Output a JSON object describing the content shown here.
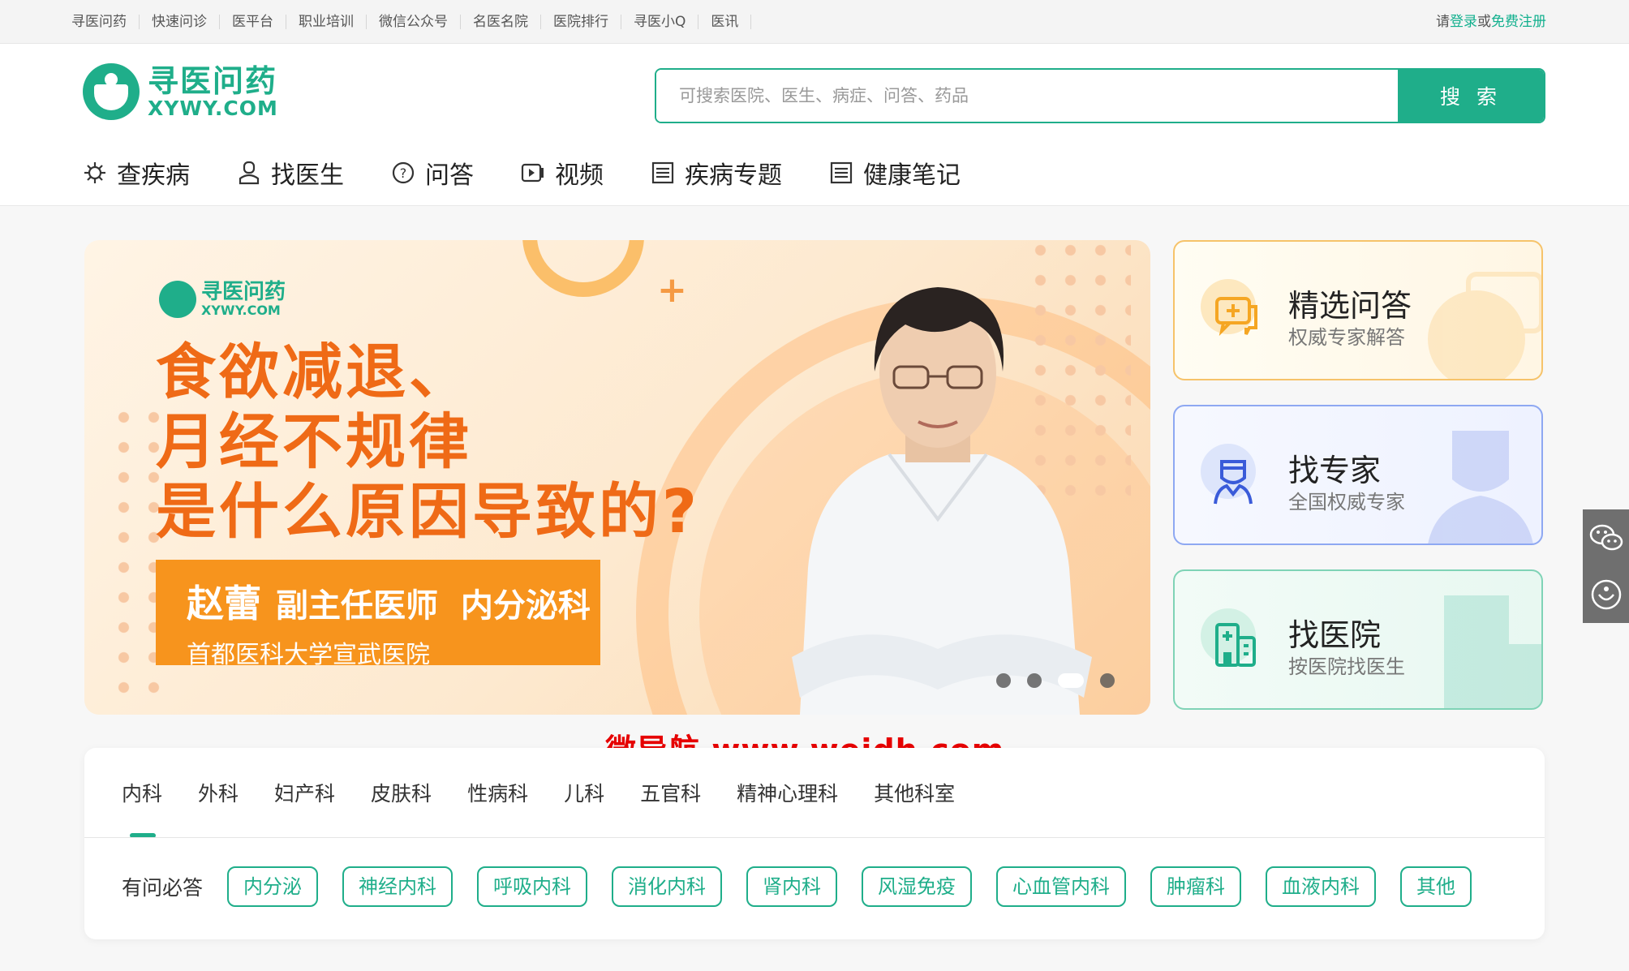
{
  "topbar": {
    "links": [
      "寻医问药",
      "快速问诊",
      "医平台",
      "职业培训",
      "微信公众号",
      "名医名院",
      "医院排行",
      "寻医小Q",
      "医讯"
    ],
    "login_prefix": "请",
    "login": "登录",
    "or": "或",
    "register": "免费注册"
  },
  "logo": {
    "cn": "寻医问药",
    "en": "XYWY.COM"
  },
  "search": {
    "placeholder": "可搜索医院、医生、病症、问答、药品",
    "button": "搜 索"
  },
  "nav": [
    {
      "label": "查疾病",
      "icon": "virus-icon"
    },
    {
      "label": "找医生",
      "icon": "doctor-icon"
    },
    {
      "label": "问答",
      "icon": "question-icon"
    },
    {
      "label": "视频",
      "icon": "video-icon"
    },
    {
      "label": "疾病专题",
      "icon": "topic-icon"
    },
    {
      "label": "健康笔记",
      "icon": "note-icon"
    }
  ],
  "banner": {
    "logo_cn": "寻医问药",
    "logo_en": "XYWY.COM",
    "headline": [
      "食欲减退、",
      "月经不规律",
      "是什么原因导致的?"
    ],
    "doctor_name": "赵蕾",
    "doctor_title": "副主任医师",
    "department": "内分泌科",
    "hospital": "首都医科大学宣武医院",
    "slides": 4,
    "active_slide": 3
  },
  "cards": [
    {
      "title": "精选问答",
      "sub": "权威专家解答",
      "icon": "chat-plus-icon",
      "color": "#f5a623"
    },
    {
      "title": "找专家",
      "sub": "全国权威专家",
      "icon": "expert-icon",
      "color": "#3a5bd9"
    },
    {
      "title": "找医院",
      "sub": "按医院找医生",
      "icon": "hospital-icon",
      "color": "#1fae8a"
    }
  ],
  "departments": {
    "tabs": [
      "内科",
      "外科",
      "妇产科",
      "皮肤科",
      "性病科",
      "儿科",
      "五官科",
      "精神心理科",
      "其他科室"
    ],
    "active_tab": 0,
    "row_label": "有问必答",
    "tags": [
      "内分泌",
      "神经内科",
      "呼吸内科",
      "消化内科",
      "肾内科",
      "风湿免疫",
      "心血管内科",
      "肿瘤科",
      "血液内科",
      "其他"
    ]
  },
  "watermark": "微导航 www.weidh.com",
  "colors": {
    "brand": "#1fae8a",
    "accent_orange": "#ef6a16",
    "tag_orange": "#f7941d"
  }
}
